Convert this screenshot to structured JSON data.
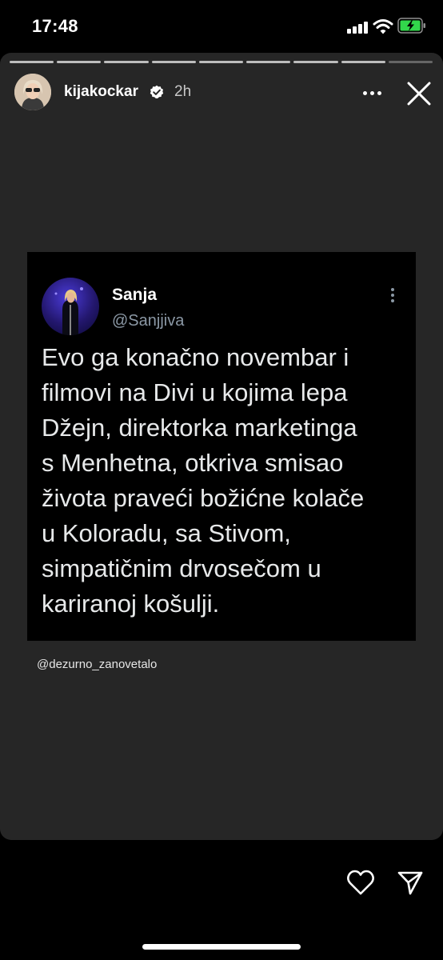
{
  "status_bar": {
    "time": "17:48",
    "battery_state": "charging",
    "accent": "#ffffff"
  },
  "story": {
    "segments_total": 9,
    "segments_viewed": 8,
    "username": "kijakockar",
    "verified": true,
    "time_ago": "2h",
    "mention": "@dezurno_zanovetalo"
  },
  "tweet": {
    "name": "Sanja",
    "handle": "@Sanjjiva",
    "text": "Evo ga konačno novembar i\nfilmovi na Divi u kojima lepa\nDžejn, direktorka marketinga\ns Menhetna, otkriva smisao\nživota praveći božićne kolače\nu Koloradu, sa Stivom,\nsimpatičnim drvosečom u\nkariranoj košulji."
  },
  "icons": {
    "more": "more-horizontal-icon",
    "close": "close-icon",
    "like": "heart-icon",
    "send": "send-icon"
  },
  "colors": {
    "story_bg": "#262626",
    "card_bg": "#000000",
    "handle": "#8b98a5",
    "battery": "#32d74b"
  }
}
